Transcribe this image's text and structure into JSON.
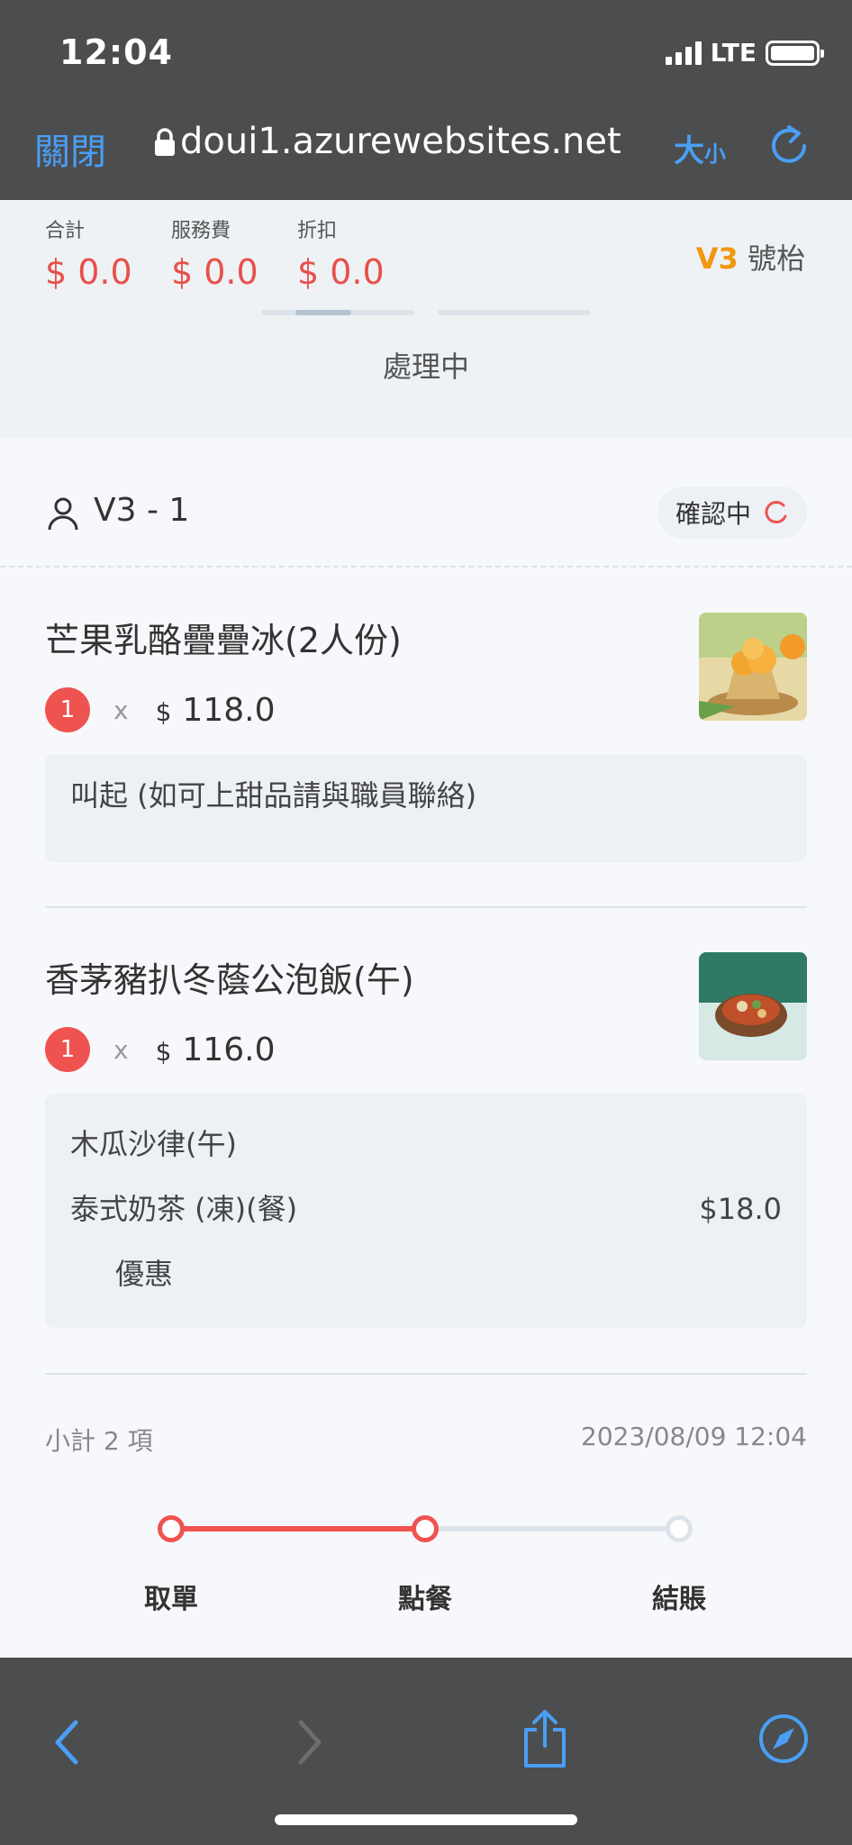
{
  "status": {
    "time": "12:04",
    "network": "LTE"
  },
  "browser": {
    "close_label": "關閉",
    "url": "doui1.azurewebsites.net",
    "size_label": "大",
    "size_small": "小"
  },
  "summary": {
    "total_label": "合計",
    "total_value": "$ 0.0",
    "service_label": "服務費",
    "service_value": "$ 0.0",
    "discount_label": "折扣",
    "discount_value": "$ 0.0",
    "table_code": "V3",
    "table_suffix": "號枱",
    "processing_label": "處理中"
  },
  "order": {
    "name": "V3 - 1",
    "status_label": "確認中",
    "items": [
      {
        "title": "芒果乳酪疊疊冰(2人份)",
        "qty": "1",
        "times": "x",
        "currency": "$",
        "price": "118.0",
        "notes": [
          {
            "text": "叫起 (如可上甜品請與職員聯絡)",
            "price": ""
          }
        ]
      },
      {
        "title": "香茅豬扒冬蔭公泡飯(午)",
        "qty": "1",
        "times": "x",
        "currency": "$",
        "price": "116.0",
        "notes": [
          {
            "text": "木瓜沙律(午)",
            "price": ""
          },
          {
            "text": "泰式奶茶 (凍)(餐)",
            "price": "$18.0"
          },
          {
            "text": "優惠",
            "price": ""
          }
        ]
      }
    ],
    "subtotal_label": "小計 2 項",
    "timestamp": "2023/08/09 12:04"
  },
  "progress": {
    "steps": [
      "取單",
      "點餐",
      "結賬"
    ],
    "completed": 2,
    "accent": "#ef5350"
  },
  "colors": {
    "accent_blue": "#4a9ff5",
    "price_red": "#e8504a",
    "table_orange": "#f0980f"
  }
}
